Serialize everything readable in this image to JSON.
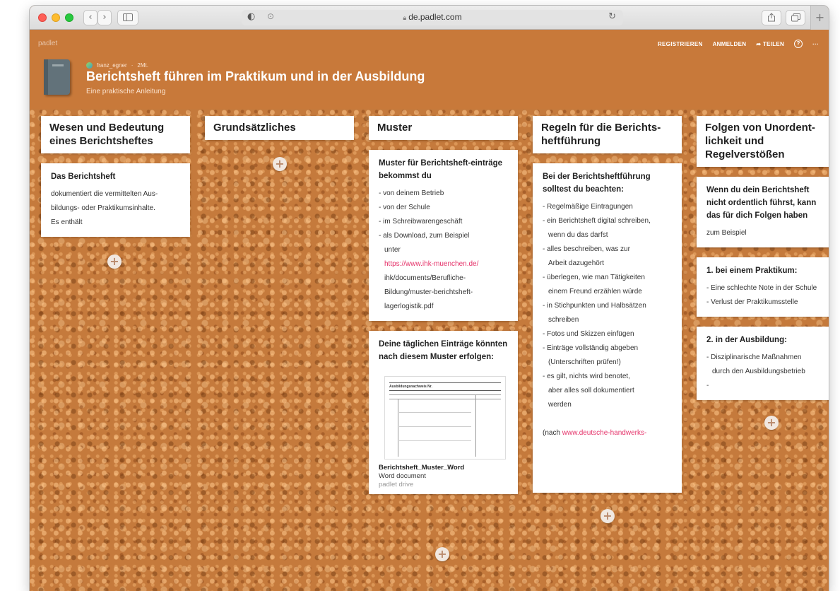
{
  "browser": {
    "url": "de.padlet.com",
    "back": "‹",
    "forward": "›",
    "new_tab": "+"
  },
  "header": {
    "brand": "padlet",
    "nav": [
      "REGISTRIEREN",
      "ANMELDEN",
      "TEILEN",
      "?",
      "···"
    ],
    "author": "franz_egner",
    "age": "2Mt.",
    "title": "Berichtsheft führen im Praktikum und in der Ausbildung",
    "subtitle": "Eine praktische Anleitung"
  },
  "columns": [
    {
      "heading": "Wesen und Bedeutung eines Berichtsheftes",
      "cards": [
        {
          "title": "Das Berichtsheft",
          "lines": [
            "dokumentiert die vermittelten Aus-",
            "bildungs- oder Praktikumsinhalte.",
            "Es enthält"
          ]
        }
      ]
    },
    {
      "heading": "Grundsätzliches",
      "cards": []
    },
    {
      "heading": "Muster",
      "cards": [
        {
          "title": "Muster für Berichtsheft-einträge bekommst du",
          "lines": [
            "- von deinem Betrieb",
            "- von der Schule",
            "- im Schreibwarengeschäft",
            "- als Download, zum Beispiel",
            "unter"
          ],
          "link": "https://www.ihk-muenchen.de/",
          "link_rest": [
            "ihk/documents/Berufliche-",
            "Bildung/muster-berichtsheft-",
            "lagerlogistik.pdf"
          ]
        },
        {
          "title": "Deine täglichen Einträge könnten nach diesem Muster erfolgen:",
          "file": {
            "name": "Berichtsheft_Muster_Word",
            "type": "Word document",
            "source": "padlet drive",
            "doc_title": "Ausbildungsnachweis Nr."
          }
        }
      ]
    },
    {
      "heading": "Regeln für die Berichts-heftführung",
      "cards": [
        {
          "title": "Bei der Berichtsheftführung solltest du beachten:",
          "lines": [
            "- Regelmäßige Eintragungen",
            "- ein Berichtsheft digital schreiben,",
            "wenn du das darfst",
            "- alles beschreiben, was zur",
            "Arbeit dazugehört",
            "- überlegen, wie man Tätigkeiten",
            "einem Freund erzählen würde",
            "- in Stichpunkten und Halbsätzen",
            "schreiben",
            "- Fotos und Skizzen einfügen",
            "- Einträge vollständig abgeben",
            "(Unterschriften prüfen!)",
            "- es gilt, nichts wird benotet,",
            "aber alles soll dokumentiert",
            "werden"
          ],
          "source_prefix": "(nach ",
          "source_link": "www.deutsche-handwerks-"
        }
      ]
    },
    {
      "heading": "Folgen von Unordent-lichkeit und Regelverstößen",
      "cards": [
        {
          "title": "Wenn du dein Berichtsheft nicht ordentlich führst, kann das für dich Folgen haben",
          "lines": [
            "zum Beispiel"
          ]
        },
        {
          "title": "1. bei einem Praktikum:",
          "lines": [
            "- Eine schlechte Note in der Schule",
            "- Verlust der Praktikumsstelle"
          ]
        },
        {
          "title": "2. in der Ausbildung:",
          "lines": [
            "- Disziplinarische Maßnahmen",
            "durch den Ausbildungsbetrieb",
            "-"
          ]
        }
      ]
    }
  ],
  "add_label": "+",
  "colors": {
    "board": "#c57a3c",
    "header": "#c8793a",
    "link": "#e5336a"
  }
}
